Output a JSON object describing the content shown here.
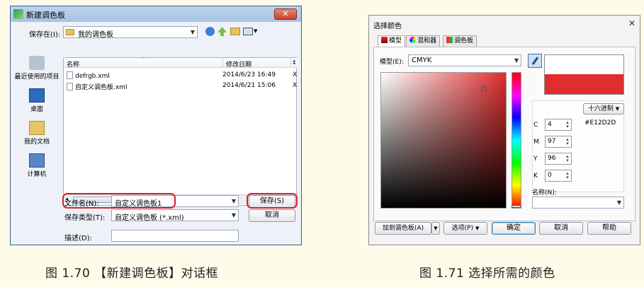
{
  "dialog1": {
    "title": "新建调色板",
    "close": "✕",
    "save_in_label": "保存在(I):",
    "save_in_value": "我的调色板",
    "places": [
      "最近使用的项目",
      "桌面",
      "我的文档",
      "计算机"
    ],
    "columns": [
      "名称",
      "修改日期",
      "‡"
    ],
    "files": [
      {
        "name": "defrgb.xml",
        "date": "2014/6/23 16:49",
        "extra": "X"
      },
      {
        "name": "自定义调色板.xml",
        "date": "2014/6/21 15:06",
        "extra": "X"
      }
    ],
    "scroll_mark": "III",
    "filename_label": "文件名(N):",
    "filename_value": "自定义调色板1",
    "filetype_label": "保存类型(T):",
    "filetype_value": "自定义调色板 (*.xml)",
    "desc_label": "描述(D):",
    "save_button": "保存(S)",
    "cancel_button": "取消"
  },
  "dialog2": {
    "title": "选择颜色",
    "close": "✕",
    "tabs": [
      "模型",
      "混和器",
      "调色板"
    ],
    "model_label": "模型(E):",
    "model_value": "CMYK",
    "preview_top": "#ffffff",
    "preview_bottom": "#e12d2d",
    "hex_mode": "十六进制",
    "hex_value": "#E12D2D",
    "channels": [
      {
        "label": "C",
        "value": "4"
      },
      {
        "label": "M",
        "value": "97"
      },
      {
        "label": "Y",
        "value": "96"
      },
      {
        "label": "K",
        "value": "0"
      }
    ],
    "name_label": "名称(N):",
    "add_palette_button": "加到调色板(A)",
    "options_button": "选项(P)",
    "ok_button": "确定",
    "cancel_button": "取消",
    "help_button": "帮助"
  },
  "captions": {
    "fig1": "图 1.70   【新建调色板】对话框",
    "fig2": "图 1.71   选择所需的颜色"
  }
}
